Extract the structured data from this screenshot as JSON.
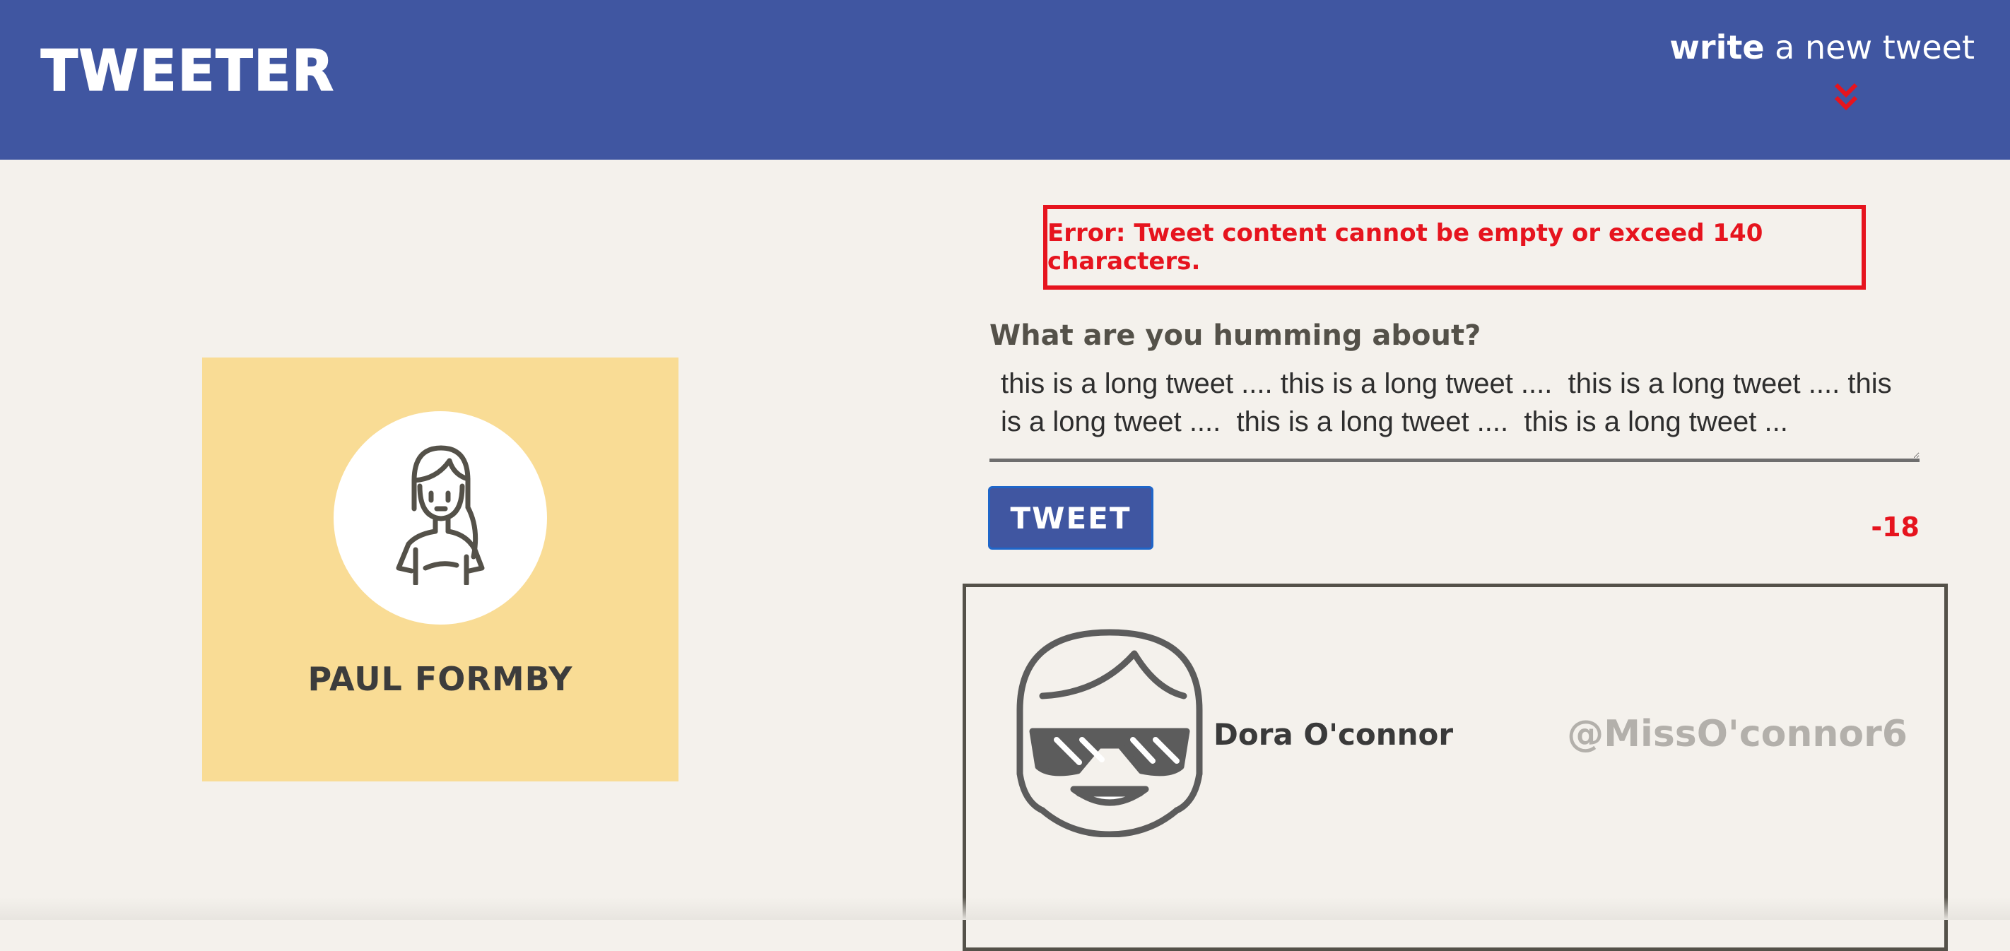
{
  "nav": {
    "brand": "TWEETER",
    "compose_bold": "write",
    "compose_rest": " a new tweet",
    "compose_icon": "double-chevron-down-icon",
    "bg_color": "#4056a1"
  },
  "profile": {
    "name": "PAUL FORMBY",
    "avatar_icon": "user-avatar-icon",
    "bg_color": "#f9dc95"
  },
  "compose": {
    "error": "Error: Tweet content cannot be empty or exceed 140 characters.",
    "label": "What are you humming about?",
    "text": "this is a long tweet .... this is a long tweet ....  this is a long tweet .... this is a long tweet ....  this is a long tweet ....  this is a long tweet ...",
    "button": "TWEET",
    "counter": "-18",
    "error_color": "#e6141e"
  },
  "tweet": {
    "name": "Dora O'connor",
    "handle": "@MissO'connor6",
    "avatar_icon": "user-avatar-icon"
  }
}
